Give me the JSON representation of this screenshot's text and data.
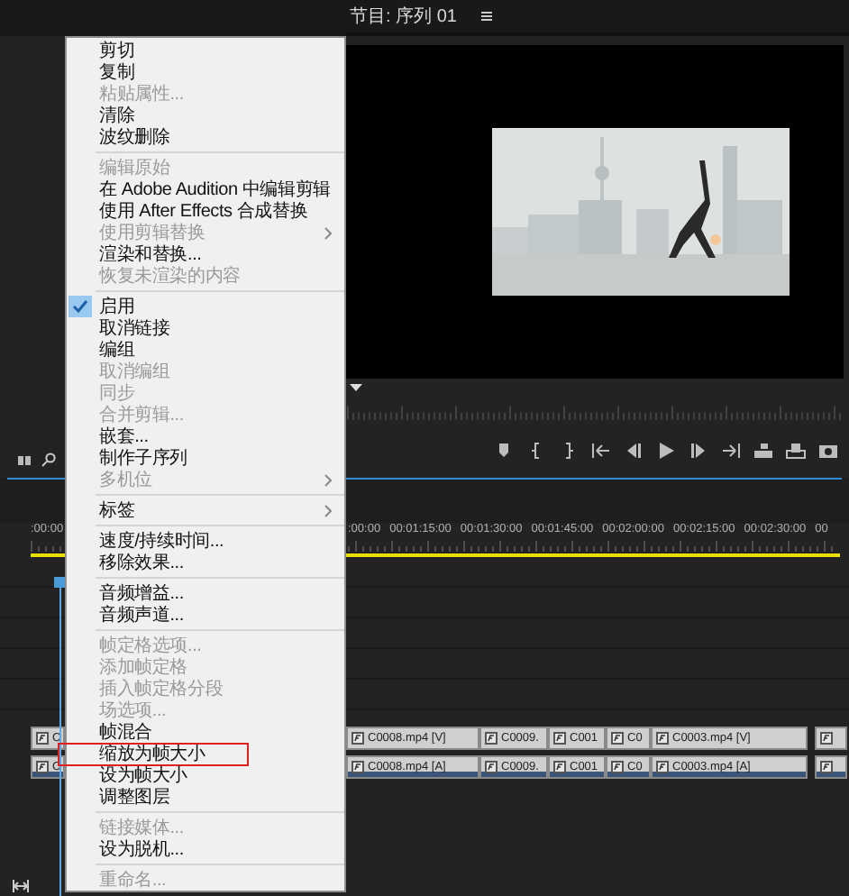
{
  "panel_tab": {
    "title": "节目: 序列 01"
  },
  "context_menu": {
    "groups": [
      {
        "items": [
          {
            "label": "剪切",
            "disabled": false,
            "checked": false,
            "submenu": false,
            "highlighted": false
          },
          {
            "label": "复制",
            "disabled": false,
            "checked": false,
            "submenu": false,
            "highlighted": false
          },
          {
            "label": "粘贴属性...",
            "disabled": true,
            "checked": false,
            "submenu": false,
            "highlighted": false
          },
          {
            "label": "清除",
            "disabled": false,
            "checked": false,
            "submenu": false,
            "highlighted": false
          },
          {
            "label": "波纹删除",
            "disabled": false,
            "checked": false,
            "submenu": false,
            "highlighted": false
          }
        ]
      },
      {
        "items": [
          {
            "label": "编辑原始",
            "disabled": true,
            "checked": false,
            "submenu": false,
            "highlighted": false
          },
          {
            "label": "在 Adobe Audition 中编辑剪辑",
            "disabled": false,
            "checked": false,
            "submenu": false,
            "highlighted": false
          },
          {
            "label": "使用 After Effects 合成替换",
            "disabled": false,
            "checked": false,
            "submenu": false,
            "highlighted": false
          },
          {
            "label": "使用剪辑替换",
            "disabled": true,
            "checked": false,
            "submenu": true,
            "highlighted": false
          },
          {
            "label": "渲染和替换...",
            "disabled": false,
            "checked": false,
            "submenu": false,
            "highlighted": false
          },
          {
            "label": "恢复未渲染的内容",
            "disabled": true,
            "checked": false,
            "submenu": false,
            "highlighted": false
          }
        ]
      },
      {
        "items": [
          {
            "label": "启用",
            "disabled": false,
            "checked": true,
            "submenu": false,
            "highlighted": false
          },
          {
            "label": "取消链接",
            "disabled": false,
            "checked": false,
            "submenu": false,
            "highlighted": false
          },
          {
            "label": "编组",
            "disabled": false,
            "checked": false,
            "submenu": false,
            "highlighted": false
          },
          {
            "label": "取消编组",
            "disabled": true,
            "checked": false,
            "submenu": false,
            "highlighted": false
          },
          {
            "label": "同步",
            "disabled": true,
            "checked": false,
            "submenu": false,
            "highlighted": false
          },
          {
            "label": "合并剪辑...",
            "disabled": true,
            "checked": false,
            "submenu": false,
            "highlighted": false
          },
          {
            "label": "嵌套...",
            "disabled": false,
            "checked": false,
            "submenu": false,
            "highlighted": false
          },
          {
            "label": "制作子序列",
            "disabled": false,
            "checked": false,
            "submenu": false,
            "highlighted": false
          },
          {
            "label": "多机位",
            "disabled": true,
            "checked": false,
            "submenu": true,
            "highlighted": false
          }
        ]
      },
      {
        "items": [
          {
            "label": "标签",
            "disabled": false,
            "checked": false,
            "submenu": true,
            "highlighted": false
          }
        ]
      },
      {
        "items": [
          {
            "label": "速度/持续时间...",
            "disabled": false,
            "checked": false,
            "submenu": false,
            "highlighted": false
          },
          {
            "label": "移除效果...",
            "disabled": false,
            "checked": false,
            "submenu": false,
            "highlighted": false
          }
        ]
      },
      {
        "items": [
          {
            "label": "音频增益...",
            "disabled": false,
            "checked": false,
            "submenu": false,
            "highlighted": false
          },
          {
            "label": "音频声道...",
            "disabled": false,
            "checked": false,
            "submenu": false,
            "highlighted": false
          }
        ]
      },
      {
        "items": [
          {
            "label": "帧定格选项...",
            "disabled": true,
            "checked": false,
            "submenu": false,
            "highlighted": false
          },
          {
            "label": "添加帧定格",
            "disabled": true,
            "checked": false,
            "submenu": false,
            "highlighted": false
          },
          {
            "label": "插入帧定格分段",
            "disabled": true,
            "checked": false,
            "submenu": false,
            "highlighted": false
          },
          {
            "label": "场选项...",
            "disabled": true,
            "checked": false,
            "submenu": false,
            "highlighted": false
          },
          {
            "label": "帧混合",
            "disabled": false,
            "checked": false,
            "submenu": false,
            "highlighted": false
          },
          {
            "label": "缩放为帧大小",
            "disabled": false,
            "checked": false,
            "submenu": false,
            "highlighted": true
          },
          {
            "label": "设为帧大小",
            "disabled": false,
            "checked": false,
            "submenu": false,
            "highlighted": false
          },
          {
            "label": "调整图层",
            "disabled": false,
            "checked": false,
            "submenu": false,
            "highlighted": false
          }
        ]
      },
      {
        "items": [
          {
            "label": "链接媒体...",
            "disabled": true,
            "checked": false,
            "submenu": false,
            "highlighted": false
          },
          {
            "label": "设为脱机...",
            "disabled": false,
            "checked": false,
            "submenu": false,
            "highlighted": false
          }
        ]
      },
      {
        "items": [
          {
            "label": "重命名...",
            "disabled": true,
            "checked": false,
            "submenu": false,
            "highlighted": false
          }
        ]
      }
    ]
  },
  "timeline": {
    "ruler_left": ":00:00",
    "ruler_labels": [
      ":00:00",
      "00:01:15:00",
      "00:01:30:00",
      "00:01:45:00",
      "00:02:00:00",
      "00:02:15:00",
      "00:02:30:00",
      "00"
    ],
    "left_video_clip_label": "C",
    "left_audio_clip_label": "C",
    "video_clips": [
      {
        "label": "C0008.mp4 [V]"
      },
      {
        "label": "C0009."
      },
      {
        "label": "C001"
      },
      {
        "label": "C0"
      },
      {
        "label": "C0003.mp4 [V]"
      }
    ],
    "audio_clips": [
      {
        "label": "C0008.mp4 [A]"
      },
      {
        "label": "C0009."
      },
      {
        "label": "C001"
      },
      {
        "label": "C0"
      },
      {
        "label": "C0003.mp4 [A]"
      }
    ]
  }
}
